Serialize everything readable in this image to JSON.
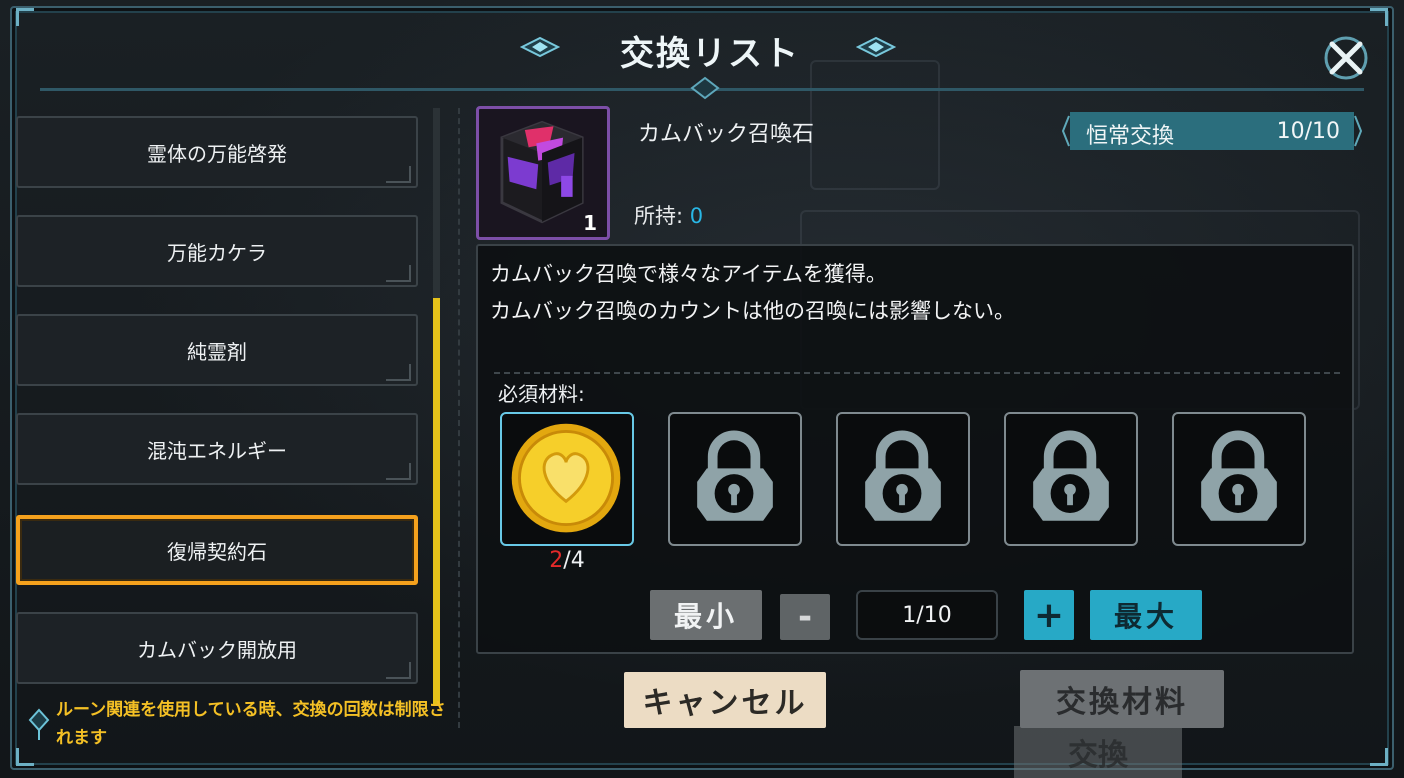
{
  "title": "交換リスト",
  "close_icon": "close-x-icon",
  "list": [
    {
      "label": "霊体の万能啓発",
      "selected": false
    },
    {
      "label": "万能カケラ",
      "selected": false
    },
    {
      "label": "純霊剤",
      "selected": false
    },
    {
      "label": "混沌エネルギー",
      "selected": false
    },
    {
      "label": "復帰契約石",
      "selected": true
    },
    {
      "label": "カムバック開放用",
      "selected": false
    }
  ],
  "notice": "ルーン関連を使用している時、交換の回数は制限されます",
  "item": {
    "name": "カムバック召喚石",
    "count": "1",
    "owned_label": "所持:",
    "owned_value": "0",
    "icon": "purple-cube-icon"
  },
  "tag": {
    "label": "恒常交換",
    "value": "10/10"
  },
  "description": [
    "カムバック召喚で様々なアイテムを獲得。",
    "カムバック召喚のカウントは他の召喚には影響しない。"
  ],
  "required_label": "必須材料:",
  "materials": [
    {
      "icon": "gold-heart-coin-icon",
      "have": "2",
      "need_sep": "/4"
    },
    {
      "icon": "lock-icon"
    },
    {
      "icon": "lock-icon"
    },
    {
      "icon": "lock-icon"
    },
    {
      "icon": "lock-icon"
    }
  ],
  "controls": {
    "min_label": "最小",
    "minus_label": "-",
    "quantity": "1/10",
    "plus_label": "+",
    "max_label": "最大"
  },
  "buttons": {
    "cancel": "キャンセル",
    "exchange": "交換材料",
    "ghost_exchange": "交換"
  },
  "colors": {
    "accent": "#27a9c6",
    "selected_border": "#f5a11d",
    "notice_text": "#f4c025",
    "owned_value": "#29b7e6",
    "material_shortage": "#e32a2a"
  }
}
